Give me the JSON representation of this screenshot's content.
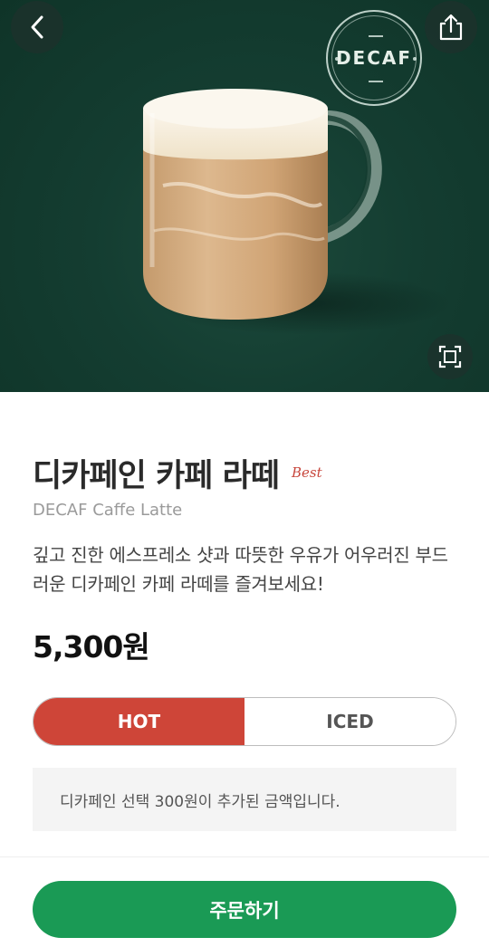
{
  "product": {
    "badge": "DECAF",
    "name_ko": "디카페인 카페 라떼",
    "best_tag": "Best",
    "name_en": "DECAF Caffe Latte",
    "description": "깊고 진한 에스프레소 샷과 따뜻한 우유가 어우러진 부드러운 디카페인 카페 라떼를 즐겨보세요!",
    "price": "5,300원"
  },
  "temperature": {
    "options": [
      "HOT",
      "ICED"
    ],
    "selected": "HOT"
  },
  "notice": "디카페인 선택 300원이 추가된 금액입니다.",
  "order_button": "주문하기",
  "icons": {
    "back": "chevron-left-icon",
    "share": "share-icon",
    "expand": "expand-icon"
  },
  "colors": {
    "hero_bg": "#143d31",
    "accent_red": "#ce4538",
    "order_green": "#1a9a55"
  }
}
